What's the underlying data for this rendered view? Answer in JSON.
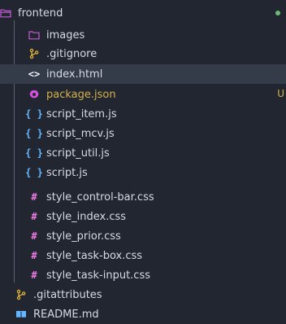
{
  "colors": {
    "background": "#222630",
    "selected_row": "#343b49",
    "folder_icon": "#c55bd6",
    "git_icon": "#e7bb39",
    "html_icon": "#f4f6fb",
    "json_icon": "#d64fe0",
    "js_icon": "#64b7ff",
    "css_icon": "#f07ae2",
    "markdown_icon": "#64b7ff",
    "status_green": "#6dbb72",
    "status_yellow": "#d4b24c"
  },
  "explorer": {
    "folder": {
      "label": "frontend",
      "icon": "folder-open-icon"
    },
    "items": [
      {
        "label": "images",
        "icon": "folder-icon",
        "level": 1
      },
      {
        "label": ".gitignore",
        "icon": "git-icon",
        "level": 1
      },
      {
        "label": "index.html",
        "icon": "html-icon",
        "level": 1,
        "selected": true
      },
      {
        "label": "package.json",
        "icon": "gear-icon",
        "level": 1
      },
      {
        "label": "script_item.js",
        "icon": "js-icon",
        "level": 1
      },
      {
        "label": "script_mcv.js",
        "icon": "js-icon",
        "level": 1
      },
      {
        "label": "script_util.js",
        "icon": "js-icon",
        "level": 1
      },
      {
        "label": "script.js",
        "icon": "js-icon",
        "level": 1
      },
      {
        "label": "style_control-bar.css",
        "icon": "css-icon",
        "level": 1
      },
      {
        "label": "style_index.css",
        "icon": "css-icon",
        "level": 1
      },
      {
        "label": "style_prior.css",
        "icon": "css-icon",
        "level": 1
      },
      {
        "label": "style_task-box.css",
        "icon": "css-icon",
        "level": 1
      },
      {
        "label": "style_task-input.css",
        "icon": "css-icon",
        "level": 1
      },
      {
        "label": ".gitattributes",
        "icon": "git-icon",
        "level": 0
      },
      {
        "label": "README.md",
        "icon": "book-icon",
        "level": 0
      }
    ],
    "status": {
      "package_json_letter": "U"
    }
  }
}
